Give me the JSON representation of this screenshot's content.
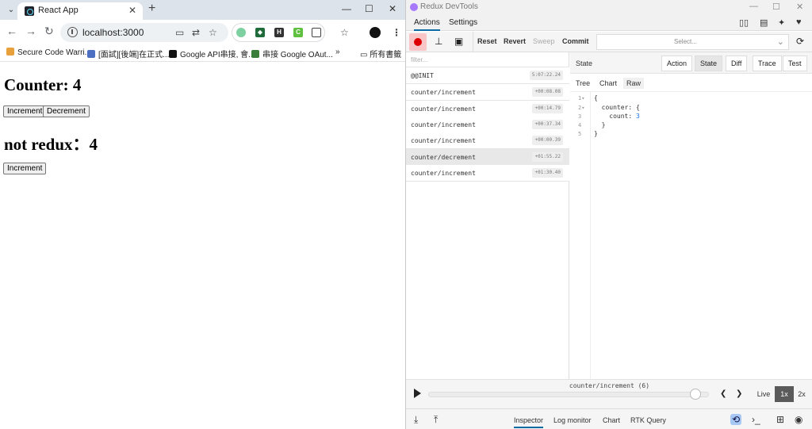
{
  "browser": {
    "tab_title": "React App",
    "new_tab_symbol": "+",
    "url": "localhost:3000",
    "bookmarks": [
      {
        "label": "Secure Code Warri...",
        "color": "#e8a13a"
      },
      {
        "label": "[面試][後端]在正式...",
        "color": "#4c6fc4"
      },
      {
        "label": "Google API串接, 會...",
        "color": "#111111"
      },
      {
        "label": "串接 Google OAut...",
        "color": "#3a7d3a"
      }
    ],
    "overflow_symbol": "»",
    "bookmarks_folder": "所有書籤"
  },
  "page": {
    "counter_heading": "Counter: 4",
    "increment_label": "Increment",
    "decrement_label": "Decrement",
    "not_redux_heading": "not redux：4",
    "increment2_label": "Increment"
  },
  "devtools": {
    "window_title": "Redux DevTools",
    "menu_tabs": [
      "Actions",
      "Settings"
    ],
    "buttons": {
      "reset": "Reset",
      "revert": "Revert",
      "sweep": "Sweep",
      "commit": "Commit"
    },
    "select_placeholder": "Select...",
    "filter_placeholder": "filter...",
    "actions": [
      {
        "name": "@@INIT",
        "time": "5:07:22.24"
      },
      {
        "name": "counter/increment",
        "time": "+00:08.08"
      },
      {
        "name": "counter/increment",
        "time": "+00:14.79"
      },
      {
        "name": "counter/increment",
        "time": "+00:37.34"
      },
      {
        "name": "counter/increment",
        "time": "+00:00.39"
      },
      {
        "name": "counter/decrement",
        "time": "+01:55.22"
      },
      {
        "name": "counter/increment",
        "time": "+01:30.40"
      }
    ],
    "state_label": "State",
    "state_tabs": [
      "Action",
      "State",
      "Diff",
      "Trace",
      "Test"
    ],
    "view_tabs": [
      "Tree",
      "Chart",
      "Raw"
    ],
    "code_lines": [
      {
        "num": "1",
        "fold": "▾",
        "text": "{"
      },
      {
        "num": "2",
        "fold": "▾",
        "text": "  counter: {"
      },
      {
        "num": "3",
        "fold": "",
        "text": "    count: ",
        "value": "3"
      },
      {
        "num": "4",
        "fold": "",
        "text": "  }"
      },
      {
        "num": "5",
        "fold": "",
        "text": "}"
      }
    ],
    "slider_label": "counter/increment (6)",
    "slider_position": 0.97,
    "live_label": "Live",
    "speeds": [
      "1x",
      "2x"
    ],
    "bottom_tabs": [
      "Inspector",
      "Log monitor",
      "Chart",
      "RTK Query"
    ]
  }
}
